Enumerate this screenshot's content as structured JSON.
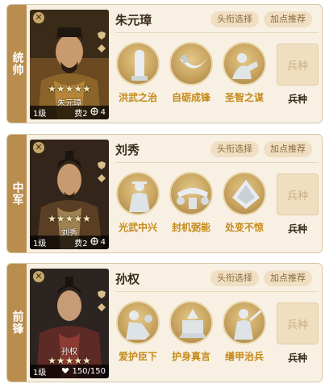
{
  "generals": [
    {
      "role": "统帅",
      "name": "朱元璋",
      "portrait_name": "朱元璋",
      "stars": "★★★★★",
      "level": "1级",
      "cost": "费2",
      "stat": "4",
      "title_button": "头衔选择",
      "recommend_button": "加点推荐",
      "skills": [
        "洪武之治",
        "自砺成锋",
        "圣智之谋"
      ],
      "troop_box": "兵种",
      "troop_label": "兵种"
    },
    {
      "role": "中军",
      "name": "刘秀",
      "portrait_name": "刘秀",
      "stars": "★★★★★",
      "level": "1级",
      "cost": "费2",
      "stat": "4",
      "title_button": "头衔选择",
      "recommend_button": "加点推荐",
      "skills": [
        "光武中兴",
        "封机弼能",
        "处变不惊"
      ],
      "troop_box": "兵种",
      "troop_label": "兵种"
    },
    {
      "role": "前锋",
      "name": "孙权",
      "portrait_name": "孙权",
      "stars": "★★★★★",
      "level": "1级",
      "cost": "",
      "stat": "150/150",
      "title_button": "头衔选择",
      "recommend_button": "加点推荐",
      "skills": [
        "爱护臣下",
        "护身真言",
        "缮甲治兵"
      ],
      "troop_box": "兵种",
      "troop_label": "兵种"
    }
  ],
  "colors": {
    "card_bg": "#f8f1e3",
    "role_strip": "#b98d4e",
    "skill_label": "#c48a1a",
    "pill_bg": "#f0dfc3"
  }
}
